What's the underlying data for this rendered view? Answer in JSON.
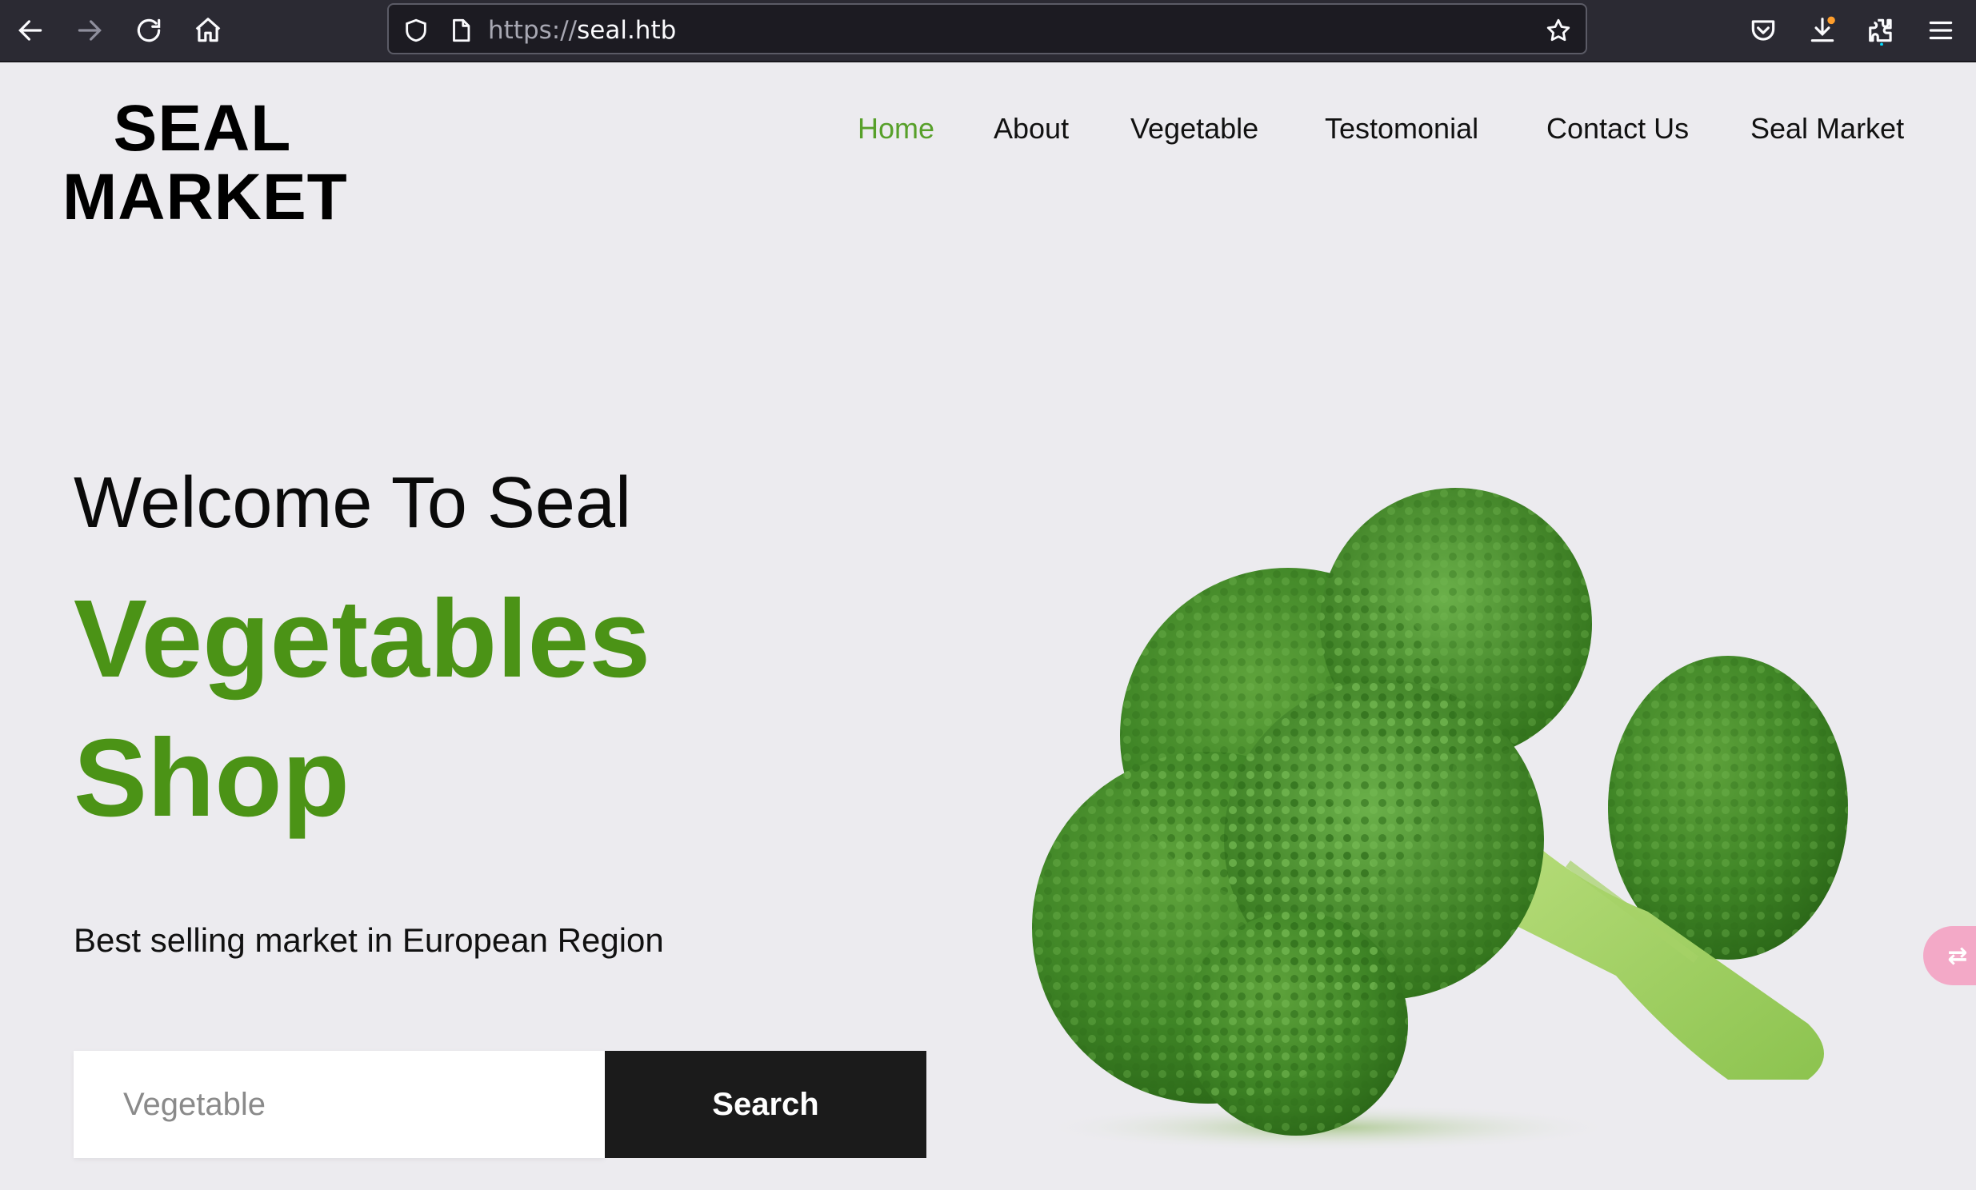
{
  "browser": {
    "url_scheme": "https://",
    "url_host": "seal.htb"
  },
  "site": {
    "logo_line1": "SEAL",
    "logo_line2": "MARKET"
  },
  "nav": {
    "items": [
      {
        "label": "Home",
        "active": true
      },
      {
        "label": "About",
        "active": false
      },
      {
        "label": "Vegetable",
        "active": false
      },
      {
        "label": "Testomonial",
        "active": false
      },
      {
        "label": "Contact Us",
        "active": false
      },
      {
        "label": "Seal Market",
        "active": false
      }
    ]
  },
  "hero": {
    "welcome": "Welcome To Seal",
    "title_line1": "Vegetables",
    "title_line2": "Shop",
    "tagline": "Best selling market in European Region",
    "search_placeholder": "Vegetable",
    "search_button": "Search",
    "image_subject": "broccoli"
  },
  "colors": {
    "accent_green": "#4b9316",
    "nav_active": "#57a02a",
    "button_dark": "#1b1b1b",
    "page_bg": "#ecebef",
    "browser_bg": "#2b2a33"
  },
  "icons": [
    "back-arrow-icon",
    "forward-arrow-icon",
    "reload-icon",
    "home-icon",
    "shield-icon",
    "page-icon",
    "star-icon",
    "pocket-icon",
    "download-icon",
    "extensions-icon",
    "menu-icon",
    "translate-icon"
  ]
}
